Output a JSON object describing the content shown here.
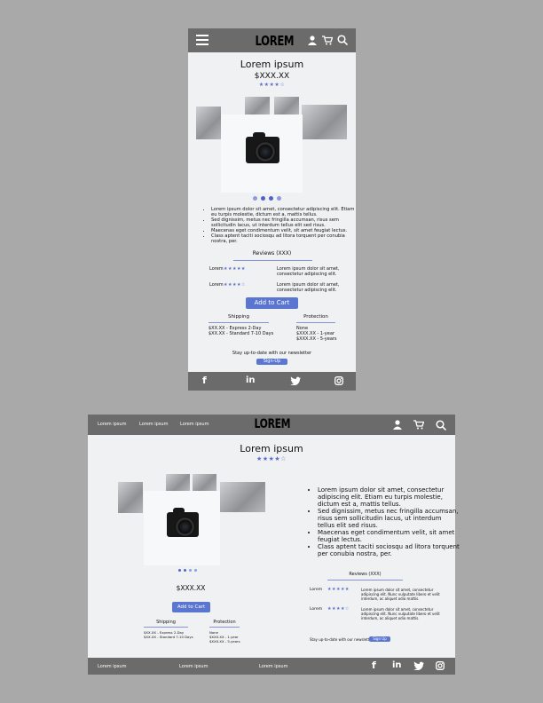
{
  "mobile": {
    "logo": "LOREM",
    "product_title": "Lorem ipsum",
    "price": "$XXX.XX",
    "rating_stars": "★★★★☆",
    "carousel_dots": 4,
    "description_bullets": [
      "Lorem ipsum dolor sit amet, consectetur adipiscing elit. Etiam eu turpis molestie, dictum est a, mattis tellus.",
      "Sed dignissim, metus nec fringilla accumsan, risus sem sollicitudin lacus, ut interdum tellus elit sed risus.",
      "Maecenas eget condimentum velit, sit amet feugiat lectus.",
      "Class aptent taciti sociosqu ad litora torquent per conubia nostra, per."
    ],
    "reviews_heading": "Reviews (XXX)",
    "reviews": [
      {
        "name": "Lorem",
        "stars": "★★★★★",
        "text": "Lorem ipsum dolor sit amet, consectetur adipiscing elit."
      },
      {
        "name": "Lorem",
        "stars": "★★★★☆",
        "text": "Lorem ipsum dolor sit amet, consectetur adipiscing elit."
      }
    ],
    "add_to_cart": "Add to Cart",
    "shipping_heading": "Shipping",
    "shipping_lines": [
      "$XX.XX - Express 2-Day",
      "$XX.XX - Standard 7-10 Days"
    ],
    "protection_heading": "Protection",
    "protection_lines": [
      "None",
      "$XXX.XX - 1-year",
      "$XXX.XX - 5-years"
    ],
    "newsletter_text": "Stay up-to-date with our newsletter",
    "signup": "Sign-Up"
  },
  "desktop": {
    "nav_links": [
      "Lorem ipsum",
      "Lorem ipsum",
      "Lorem ipsum"
    ],
    "logo": "LOREM",
    "product_title": "Lorem ipsum",
    "rating_stars": "★★★★☆",
    "price": "$XXX.XX",
    "add_to_cart": "Add to Cart",
    "shipping_heading": "Shipping",
    "shipping_lines": [
      "$XX.XX - Express 2-Day",
      "$XX.XX - Standard 7-10 Days"
    ],
    "protection_heading": "Protection",
    "protection_lines": [
      "None",
      "$XXX.XX - 1-year",
      "$XXX.XX - 5-years"
    ],
    "description_bullets": [
      "Lorem ipsum dolor sit amet, consectetur adipiscing elit. Etiam eu turpis molestie, dictum est a, mattis tellus.",
      "Sed dignissim, metus nec fringilla accumsan, risus sem sollicitudin lacus, ut interdum tellus elit sed risus.",
      "Maecenas eget condimentum velit, sit amet feugiat lectus.",
      "Class aptent taciti sociosqu ad litora torquent per conubia nostra, per."
    ],
    "reviews_heading": "Reviews (XXX)",
    "reviews": [
      {
        "name": "Lorem",
        "stars": "★★★★★",
        "text": "Lorem ipsum dolor sit amet, consectetur adipiscing elit. Nunc vulputate libero et velit interdum, ac aliquet odio mattis."
      },
      {
        "name": "Lorem",
        "stars": "★★★★☆",
        "text": "Lorem ipsum dolor sit amet, consectetur adipiscing elit. Nunc vulputate libero et velit interdum, ac aliquet odio mattis."
      }
    ],
    "newsletter_text": "Stay up-to-date with our newsletter",
    "signup": "Sign Up",
    "footer_links": [
      "Lorem ipsum",
      "Lorem ipsum",
      "Lorem ipsum"
    ]
  },
  "icons": {
    "menu": "hamburger-icon",
    "user": "user-icon",
    "cart": "cart-icon",
    "search": "search-icon",
    "facebook": "facebook-icon",
    "linkedin": "linkedin-icon",
    "twitter": "twitter-icon",
    "instagram": "instagram-icon"
  },
  "colors": {
    "page_bg": "#a9a9a9",
    "bar": "#6b6b6b",
    "content_bg": "#f0f1f3",
    "accent": "#5b76d1"
  }
}
